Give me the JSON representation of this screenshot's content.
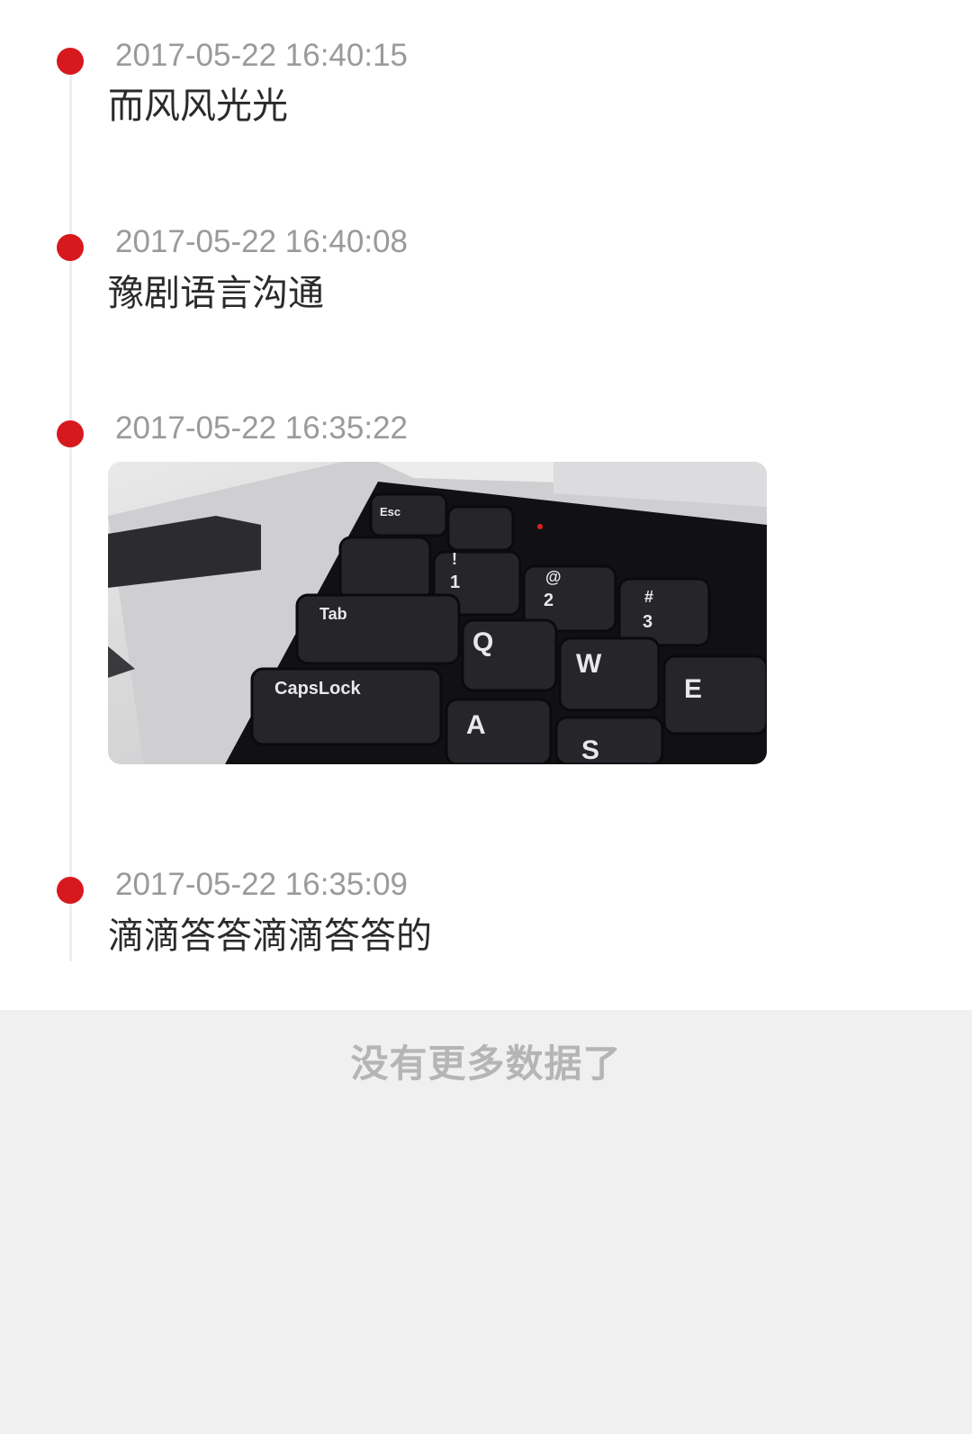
{
  "timeline": {
    "entries": [
      {
        "time": "2017-05-22 16:40:15",
        "text": "而风风光光"
      },
      {
        "time": "2017-05-22 16:40:08",
        "text": "豫剧语言沟通"
      },
      {
        "time": "2017-05-22 16:35:22",
        "image": "keyboard-photo"
      },
      {
        "time": "2017-05-22 16:35:09",
        "text": "滴滴答答滴滴答答的"
      }
    ],
    "photo_keys": {
      "esc": "Esc",
      "tab": "Tab",
      "capslock": "CapsLock",
      "q": "Q",
      "w": "W",
      "e": "E",
      "a": "A",
      "s": "S",
      "one": "1",
      "two": "2",
      "three": "3",
      "exclaim": "!",
      "at": "@",
      "hash": "#"
    }
  },
  "footer": {
    "no_more_text": "没有更多数据了"
  },
  "colors": {
    "accent": "#d7191e",
    "timestamp": "#9a9a9a",
    "footer_bg": "#f0f0f0"
  }
}
